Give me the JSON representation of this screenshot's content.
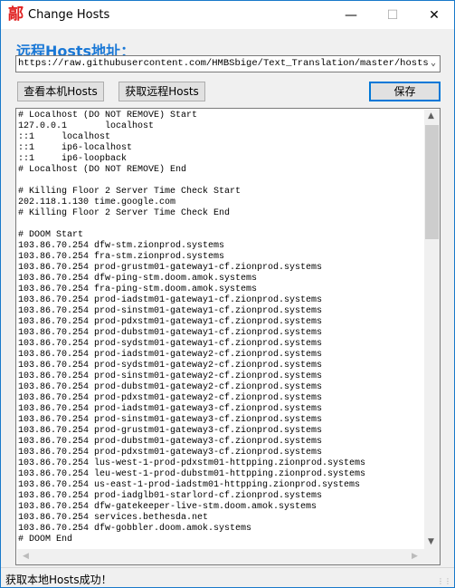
{
  "window": {
    "title": "Change Hosts",
    "icon": "鄗"
  },
  "remote_label": "远程Hosts地址：",
  "url_combo": {
    "value": "https://raw.githubusercontent.com/HMBSbige/Text_Translation/master/hosts"
  },
  "buttons": {
    "view_local": "查看本机Hosts",
    "fetch_remote": "获取远程Hosts",
    "save": "保存"
  },
  "hosts_lines": [
    "# Localhost (DO NOT REMOVE) Start",
    "127.0.0.1       localhost",
    "::1     localhost",
    "::1     ip6-localhost",
    "::1     ip6-loopback",
    "# Localhost (DO NOT REMOVE) End",
    "",
    "# Killing Floor 2 Server Time Check Start",
    "202.118.1.130 time.google.com",
    "# Killing Floor 2 Server Time Check End",
    "",
    "# DOOM Start",
    "103.86.70.254 dfw-stm.zionprod.systems",
    "103.86.70.254 fra-stm.zionprod.systems",
    "103.86.70.254 prod-grustm01-gateway1-cf.zionprod.systems",
    "103.86.70.254 dfw-ping-stm.doom.amok.systems",
    "103.86.70.254 fra-ping-stm.doom.amok.systems",
    "103.86.70.254 prod-iadstm01-gateway1-cf.zionprod.systems",
    "103.86.70.254 prod-sinstm01-gateway1-cf.zionprod.systems",
    "103.86.70.254 prod-pdxstm01-gateway1-cf.zionprod.systems",
    "103.86.70.254 prod-dubstm01-gateway1-cf.zionprod.systems",
    "103.86.70.254 prod-sydstm01-gateway1-cf.zionprod.systems",
    "103.86.70.254 prod-iadstm01-gateway2-cf.zionprod.systems",
    "103.86.70.254 prod-sydstm01-gateway2-cf.zionprod.systems",
    "103.86.70.254 prod-sinstm01-gateway2-cf.zionprod.systems",
    "103.86.70.254 prod-dubstm01-gateway2-cf.zionprod.systems",
    "103.86.70.254 prod-pdxstm01-gateway2-cf.zionprod.systems",
    "103.86.70.254 prod-iadstm01-gateway3-cf.zionprod.systems",
    "103.86.70.254 prod-sinstm01-gateway3-cf.zionprod.systems",
    "103.86.70.254 prod-grustm01-gateway3-cf.zionprod.systems",
    "103.86.70.254 prod-dubstm01-gateway3-cf.zionprod.systems",
    "103.86.70.254 prod-pdxstm01-gateway3-cf.zionprod.systems",
    "103.86.70.254 lus-west-1-prod-pdxstm01-httpping.zionprod.systems",
    "103.86.70.254 leu-west-1-prod-dubstm01-httpping.zionprod.systems",
    "103.86.70.254 us-east-1-prod-iadstm01-httpping.zionprod.systems",
    "103.86.70.254 prod-iadglb01-starlord-cf.zionprod.systems",
    "103.86.70.254 dfw-gatekeeper-live-stm.doom.amok.systems",
    "103.86.70.254 services.bethesda.net",
    "103.86.70.254 dfw-gobbler.doom.amok.systems",
    "# DOOM End"
  ],
  "status": "获取本地Hosts成功！",
  "colors": {
    "accent": "#1a78d6",
    "window_border": "#1979ca"
  }
}
